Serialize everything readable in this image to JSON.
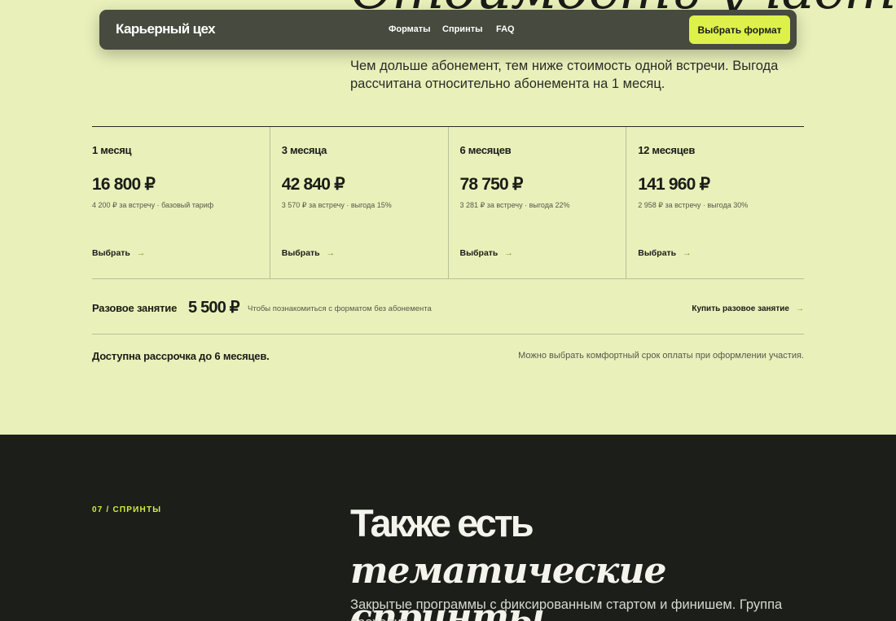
{
  "nav": {
    "logo": "Карьерный цех",
    "links": [
      "Форматы",
      "Спринты",
      "FAQ"
    ],
    "cta": "Выбрать формат"
  },
  "pricing": {
    "lead": "Чем дольше абонемент, тем ниже стоимость одной встречи. Выгода рассчитана относительно абонемента на 1 месяц.",
    "plans": [
      {
        "name": "1 месяц",
        "price": "16 800 ₽",
        "note": "4 200 ₽ за встречу · базовый тариф",
        "select": "Выбрать"
      },
      {
        "name": "3 месяца",
        "price": "42 840 ₽",
        "note": "3 570 ₽ за встречу · выгода 15%",
        "select": "Выбрать"
      },
      {
        "name": "6 месяцев",
        "price": "78 750 ₽",
        "note": "3 281 ₽ за встречу · выгода 22%",
        "select": "Выбрать"
      },
      {
        "name": "12 месяцев",
        "price": "141 960 ₽",
        "note": "2 958 ₽ за встречу · выгода 30%",
        "select": "Выбрать"
      }
    ],
    "arrow": "→",
    "single": {
      "label": "Разовое занятие",
      "price": "5 500 ₽",
      "note": "Чтобы познакомиться с форматом без абонемента",
      "buy": "Купить разовое занятие"
    },
    "installment": {
      "title": "Доступна рассрочка до 6 месяцев.",
      "note": "Можно выбрать комфортный срок оплаты при оформлении участия."
    }
  },
  "sprints": {
    "eyebrow": "07 / СПРИНТЫ",
    "title_sans": "Также есть",
    "title_serif": "тематические спринты",
    "desc": "Закрытые программы с фиксированным стартом и финишем. Группа проходит"
  },
  "colors": {
    "page_bg": "#E9F0BA",
    "dark_bg": "#1C1E1A",
    "accent": "#DDF14A",
    "navbar": "#474A3E"
  }
}
